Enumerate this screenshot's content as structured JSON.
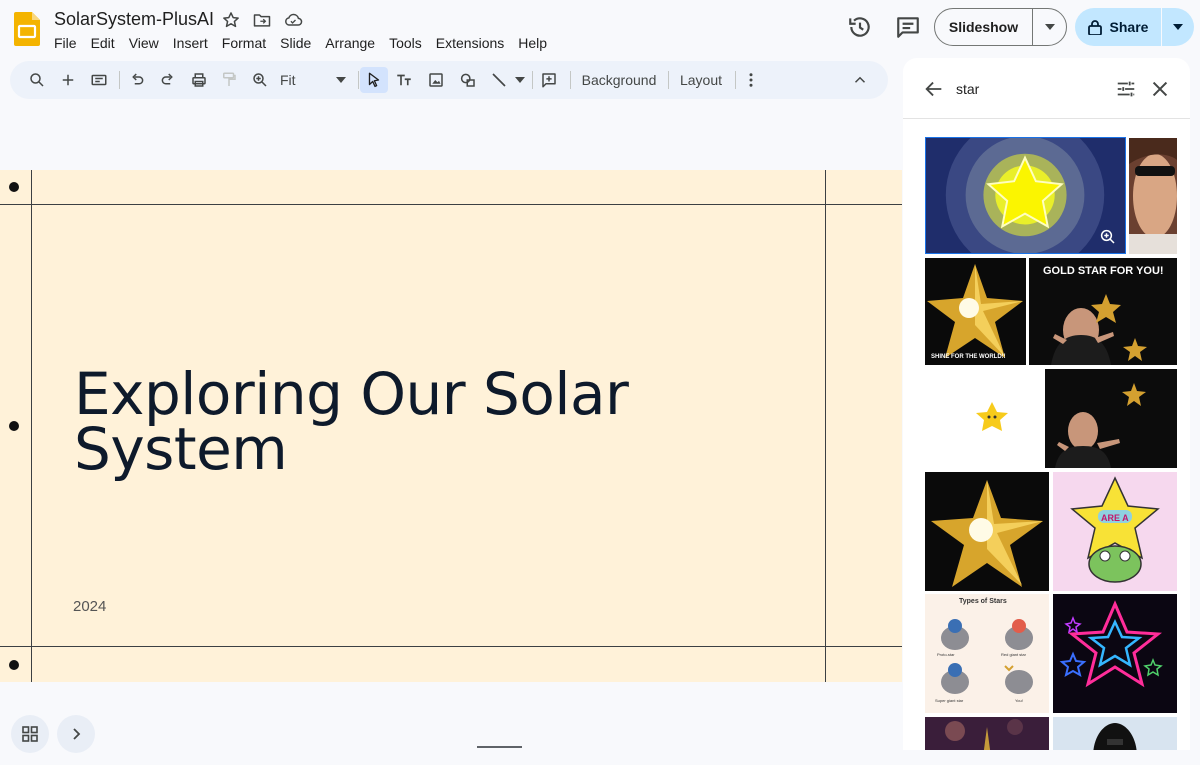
{
  "document": {
    "title": "SolarSystem-PlusAI",
    "app_color": "#f4b400"
  },
  "menu": [
    "File",
    "Edit",
    "View",
    "Insert",
    "Format",
    "Slide",
    "Arrange",
    "Tools",
    "Extensions",
    "Help"
  ],
  "header_buttons": {
    "slideshow_label": "Slideshow",
    "share_label": "Share",
    "share_color": "#c2e7ff"
  },
  "toolbar": {
    "zoom_label": "Fit",
    "background_label": "Background",
    "layout_label": "Layout",
    "icons": [
      "search-icon",
      "add-icon",
      "new-slide-icon",
      "undo-icon",
      "redo-icon",
      "print-icon",
      "paint-format-icon",
      "zoom-icon",
      "select-cursor-icon",
      "text-box-icon",
      "image-icon",
      "shape-icon",
      "line-icon",
      "comment-add-icon",
      "more-vert-icon",
      "collapse-icon"
    ]
  },
  "slide": {
    "title_line1": "Exploring Our Solar",
    "title_line2": "System",
    "year": "2024",
    "background": "#fff2d9"
  },
  "gif_panel": {
    "search_query": "star",
    "results": [
      {
        "name": "glowing-star",
        "colors": [
          "#1f2d6b",
          "#f7f000"
        ]
      },
      {
        "name": "sunglasses-woman",
        "colors": [
          "#8a5a3c"
        ]
      },
      {
        "name": "gold-star-shine",
        "caption": "SHINE FOR THE WORLD!!"
      },
      {
        "name": "gold-star-for-you",
        "caption": "GOLD STAR FOR YOU!"
      },
      {
        "name": "small-yellow-star"
      },
      {
        "name": "man-pointing-star"
      },
      {
        "name": "gold-star-sparkle"
      },
      {
        "name": "cartoon-star-frog",
        "caption": "ARE A"
      },
      {
        "name": "types-of-stars",
        "caption": "Types of Stars",
        "labels": [
          "Proto-star",
          "Red giant star",
          "Super giant star",
          "You!"
        ]
      },
      {
        "name": "neon-stars"
      },
      {
        "name": "night-sky"
      },
      {
        "name": "darth-vader"
      }
    ]
  }
}
